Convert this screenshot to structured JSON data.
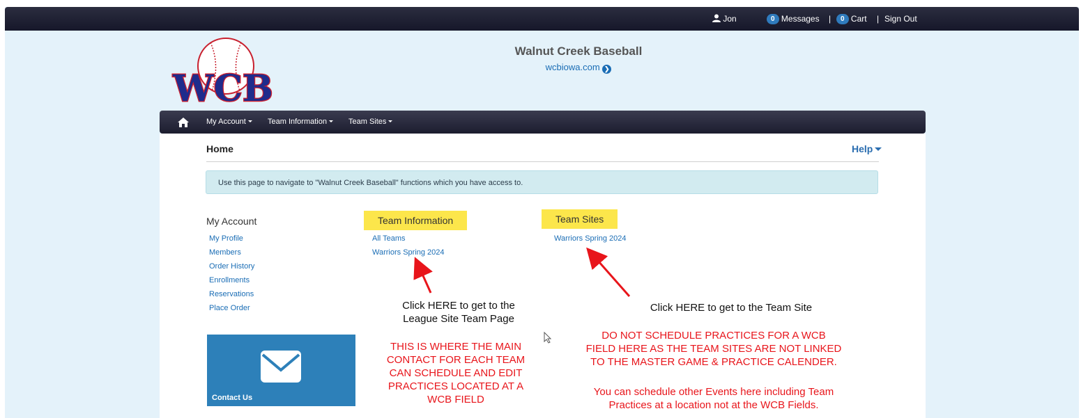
{
  "topbar": {
    "user": "Jon",
    "messages_count": "0",
    "messages_label": "Messages",
    "sep1": "|",
    "cart_count": "0",
    "cart_label": "Cart",
    "sep2": "|",
    "signout_label": "Sign Out"
  },
  "header": {
    "logo_text": "WCB",
    "title": "Walnut Creek Baseball",
    "link": "wcbiowa.com"
  },
  "nav": {
    "items": [
      "My Account",
      "Team Information",
      "Team Sites"
    ]
  },
  "page": {
    "title": "Home",
    "help": "Help",
    "info": "Use this page to navigate to \"Walnut Creek Baseball\" functions which you have access to."
  },
  "columns": {
    "my_account": {
      "title": "My Account",
      "links": [
        "My Profile",
        "Members",
        "Order History",
        "Enrollments",
        "Reservations",
        "Place Order"
      ]
    },
    "team_information": {
      "title": "Team Information",
      "links": [
        "All Teams",
        "Warriors Spring 2024"
      ]
    },
    "team_sites": {
      "title": "Team Sites",
      "links": [
        "Warriors Spring 2024"
      ]
    }
  },
  "contact": {
    "label": "Contact Us"
  },
  "annotations": {
    "left_note_1": "Click HERE to get to the",
    "left_note_2": "League Site Team Page",
    "left_red": [
      "THIS IS WHERE THE MAIN",
      "CONTACT FOR EACH TEAM",
      "CAN SCHEDULE AND EDIT",
      "PRACTICES LOCATED AT A",
      "WCB FIELD"
    ],
    "right_note": "Click HERE to get to the Team Site",
    "right_red_1": [
      "DO NOT SCHEDULE PRACTICES FOR A WCB",
      "FIELD HERE AS THE TEAM SITES ARE NOT LINKED",
      "TO THE MASTER GAME & PRACTICE CALENDER."
    ],
    "right_red_2": [
      "You can schedule other Events here including Team",
      "Practices at a location not at the WCB Fields."
    ]
  },
  "colors": {
    "link": "#1a6db5",
    "highlight": "#fce64b",
    "annotation_red": "#e8151b",
    "tile": "#2d80b9"
  }
}
